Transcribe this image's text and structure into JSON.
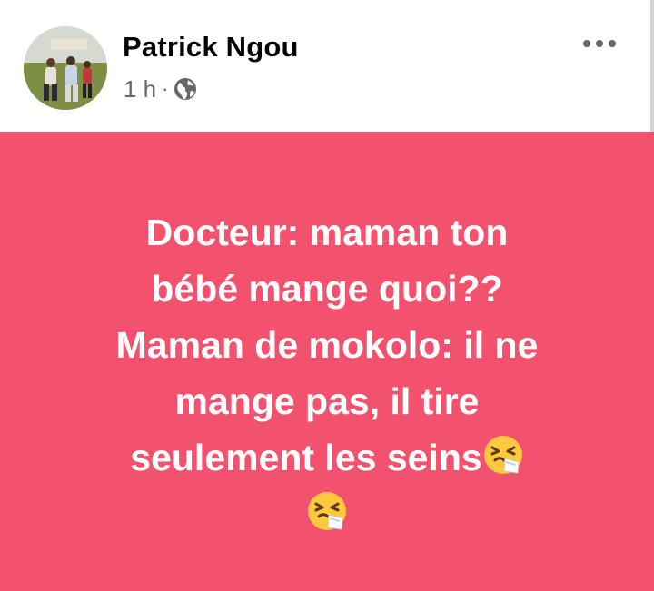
{
  "post": {
    "author": "Patrick Ngou",
    "time": "1 h",
    "separator": "·",
    "privacy_icon": "globe-icon",
    "more_icon": "more-dots-icon",
    "lines": [
      "Docteur: maman ton",
      "bébé mange quoi??",
      "Maman de mokolo: il ne",
      "mange pas, il tire",
      "seulement les seins"
    ],
    "emoji": "sneezing-face-emoji",
    "background_color": "#f2526e",
    "text_color": "#ffffff"
  }
}
